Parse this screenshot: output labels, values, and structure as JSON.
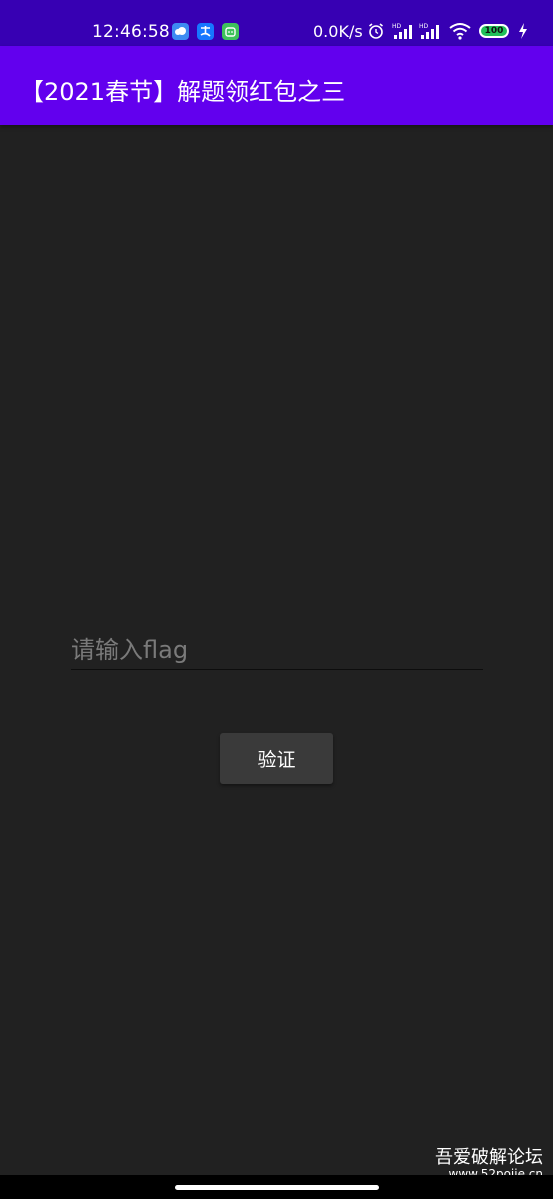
{
  "status_bar": {
    "time": "12:46:58",
    "network_speed": "0.0K/s",
    "battery_level": "100",
    "icons": [
      "weather-icon",
      "alipay-icon",
      "android-icon",
      "alarm-icon",
      "signal-hd-icon",
      "signal-hd-icon",
      "wifi-icon",
      "battery-icon",
      "charging-icon"
    ],
    "background_color": "#3700B3"
  },
  "app_bar": {
    "title": "【2021春节】解题领红包之三",
    "background_color": "#6200EE"
  },
  "form": {
    "flag_input": {
      "value": "",
      "placeholder": "请输入flag"
    },
    "verify_button_label": "验证"
  },
  "watermark": {
    "title": "吾爱破解论坛",
    "url": "www.52pojie.cn"
  },
  "colors": {
    "background": "#212121",
    "button": "#3a3a3a"
  }
}
